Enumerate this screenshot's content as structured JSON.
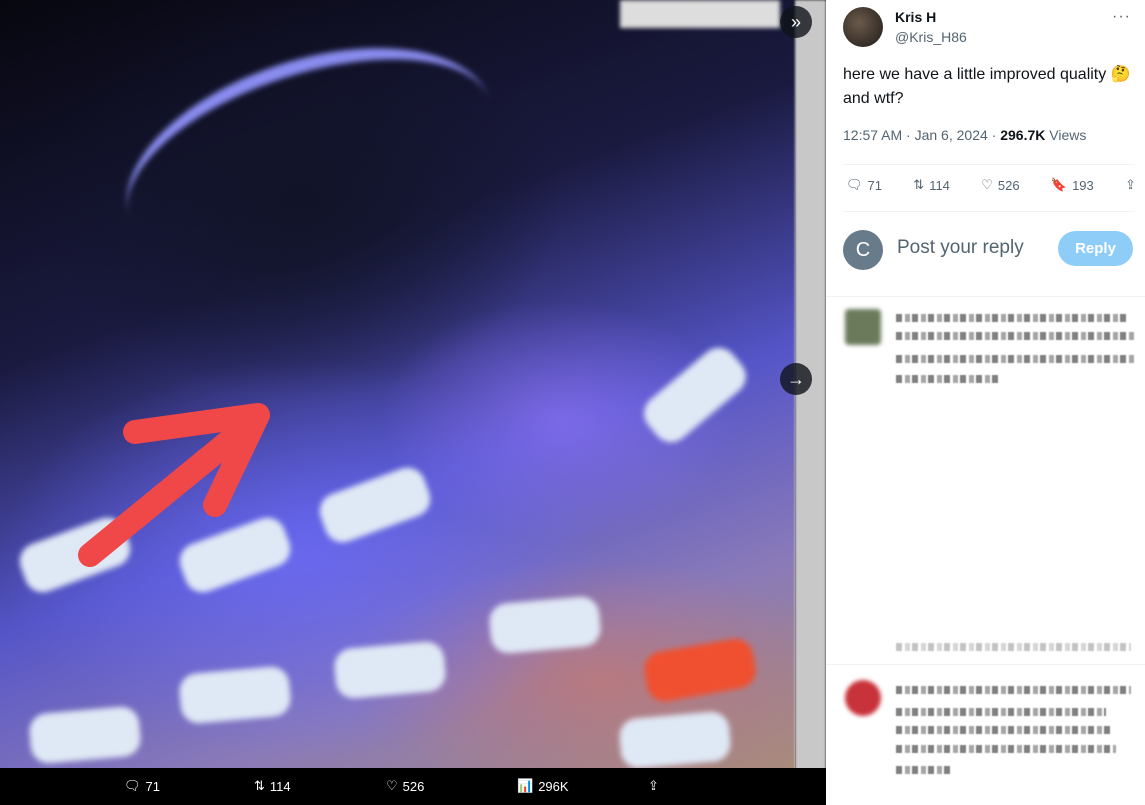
{
  "media": {
    "actions": {
      "replies": "71",
      "reposts": "114",
      "likes": "526",
      "views": "296K"
    }
  },
  "tweet": {
    "author_name": "Kris H",
    "author_handle": "@Kris_H86",
    "text": "here we have a little improved quality",
    "emoji": "🤔",
    "text_cont": "and wtf?",
    "time": "12:57 AM · Jan 6, 2024 · ",
    "views_count": "296.7K",
    "views_label": " Views",
    "stats": {
      "replies": "71",
      "reposts": "114",
      "likes": "526",
      "bookmarks": "193"
    }
  },
  "reply_box": {
    "avatar_letter": "C",
    "placeholder": "Post your reply",
    "button": "Reply"
  },
  "colors": {
    "accent": "#1d9bf0",
    "reply_button": "#8ecdf8",
    "arrow": "#f04848"
  }
}
